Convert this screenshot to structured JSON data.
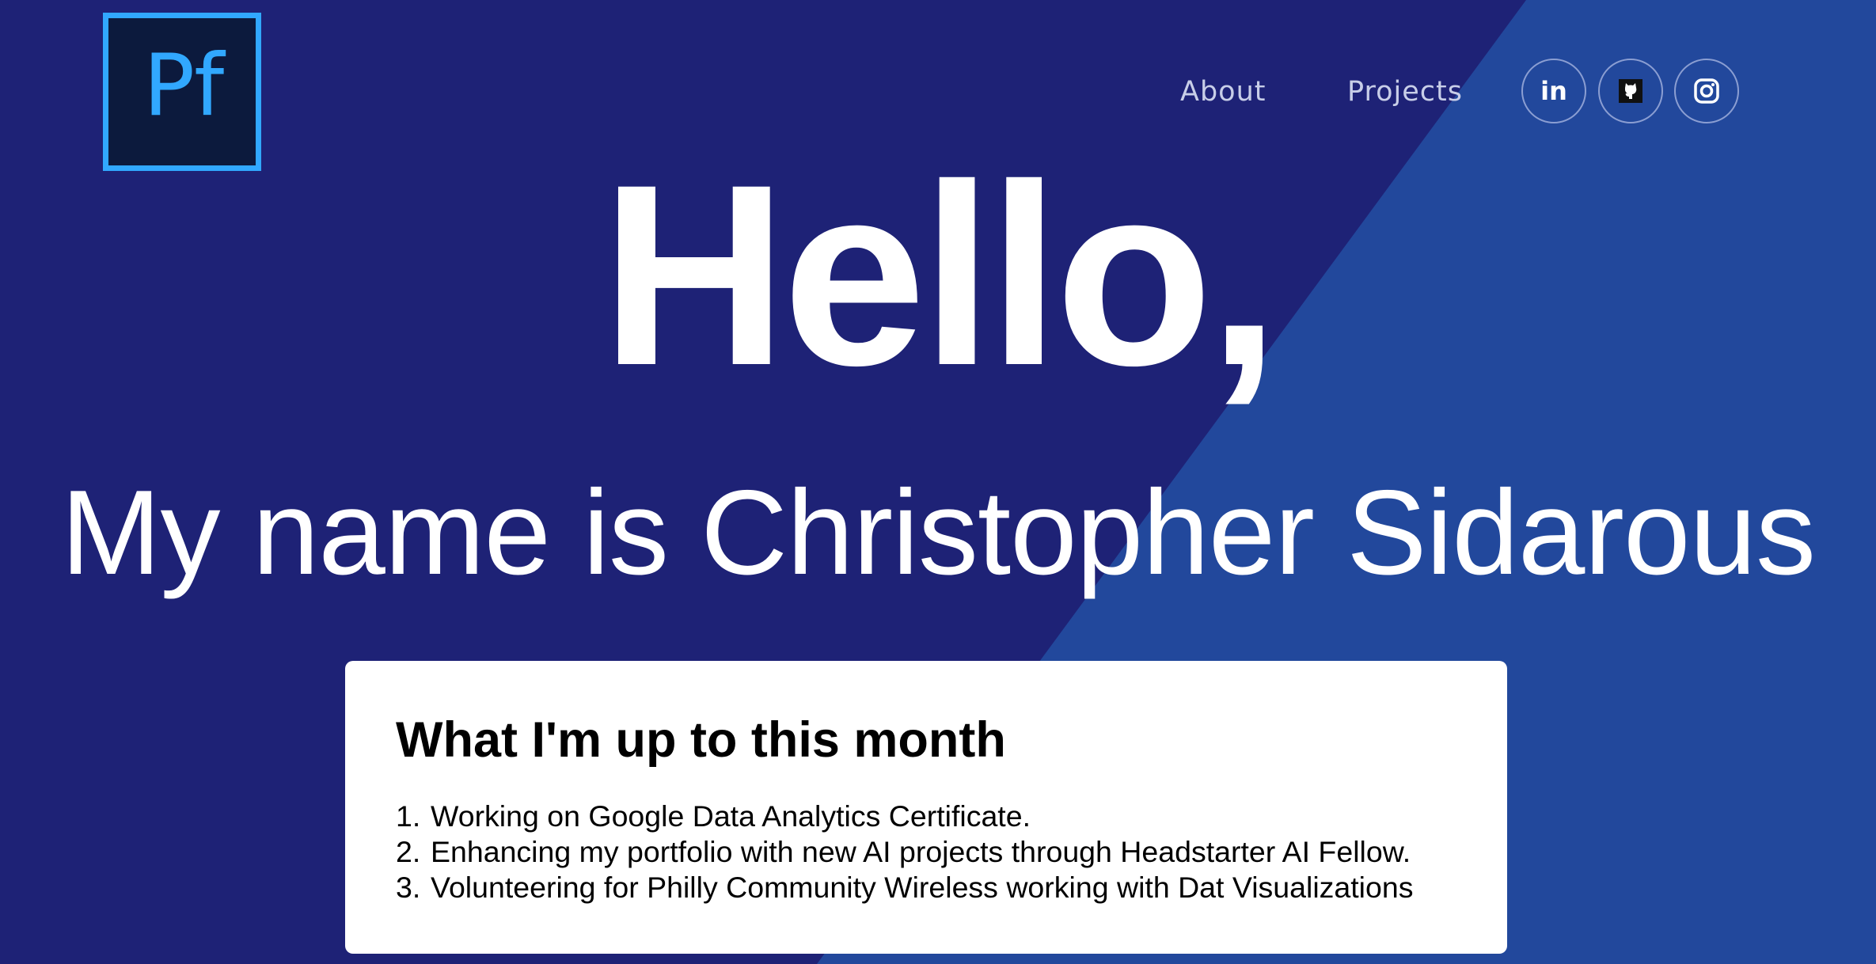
{
  "logo": {
    "text": "Pf",
    "border_color": "#31a8ff",
    "fill_color": "#0c1a3d"
  },
  "nav": {
    "about_label": "About",
    "projects_label": "Projects"
  },
  "social": [
    {
      "name": "linkedin",
      "icon": "linkedin-icon",
      "text": "in"
    },
    {
      "name": "github",
      "icon": "github-icon"
    },
    {
      "name": "instagram",
      "icon": "instagram-icon"
    }
  ],
  "hero": {
    "greeting": "Hello,",
    "name_line": "My name is Christopher Sidarous"
  },
  "card": {
    "title": "What I'm up to this month",
    "items": [
      {
        "number": "1.",
        "text": "Working on Google Data Analytics Certificate."
      },
      {
        "number": "2.",
        "text": "Enhancing my portfolio with new AI projects through Headstarter AI Fellow."
      },
      {
        "number": "3.",
        "text": "Volunteering for Philly Community Wireless working with Dat Visualizations"
      }
    ]
  },
  "colors": {
    "background_dark": "#1e2276",
    "background_light": "#22489c",
    "text": "#ffffff",
    "card_bg": "#ffffff"
  }
}
